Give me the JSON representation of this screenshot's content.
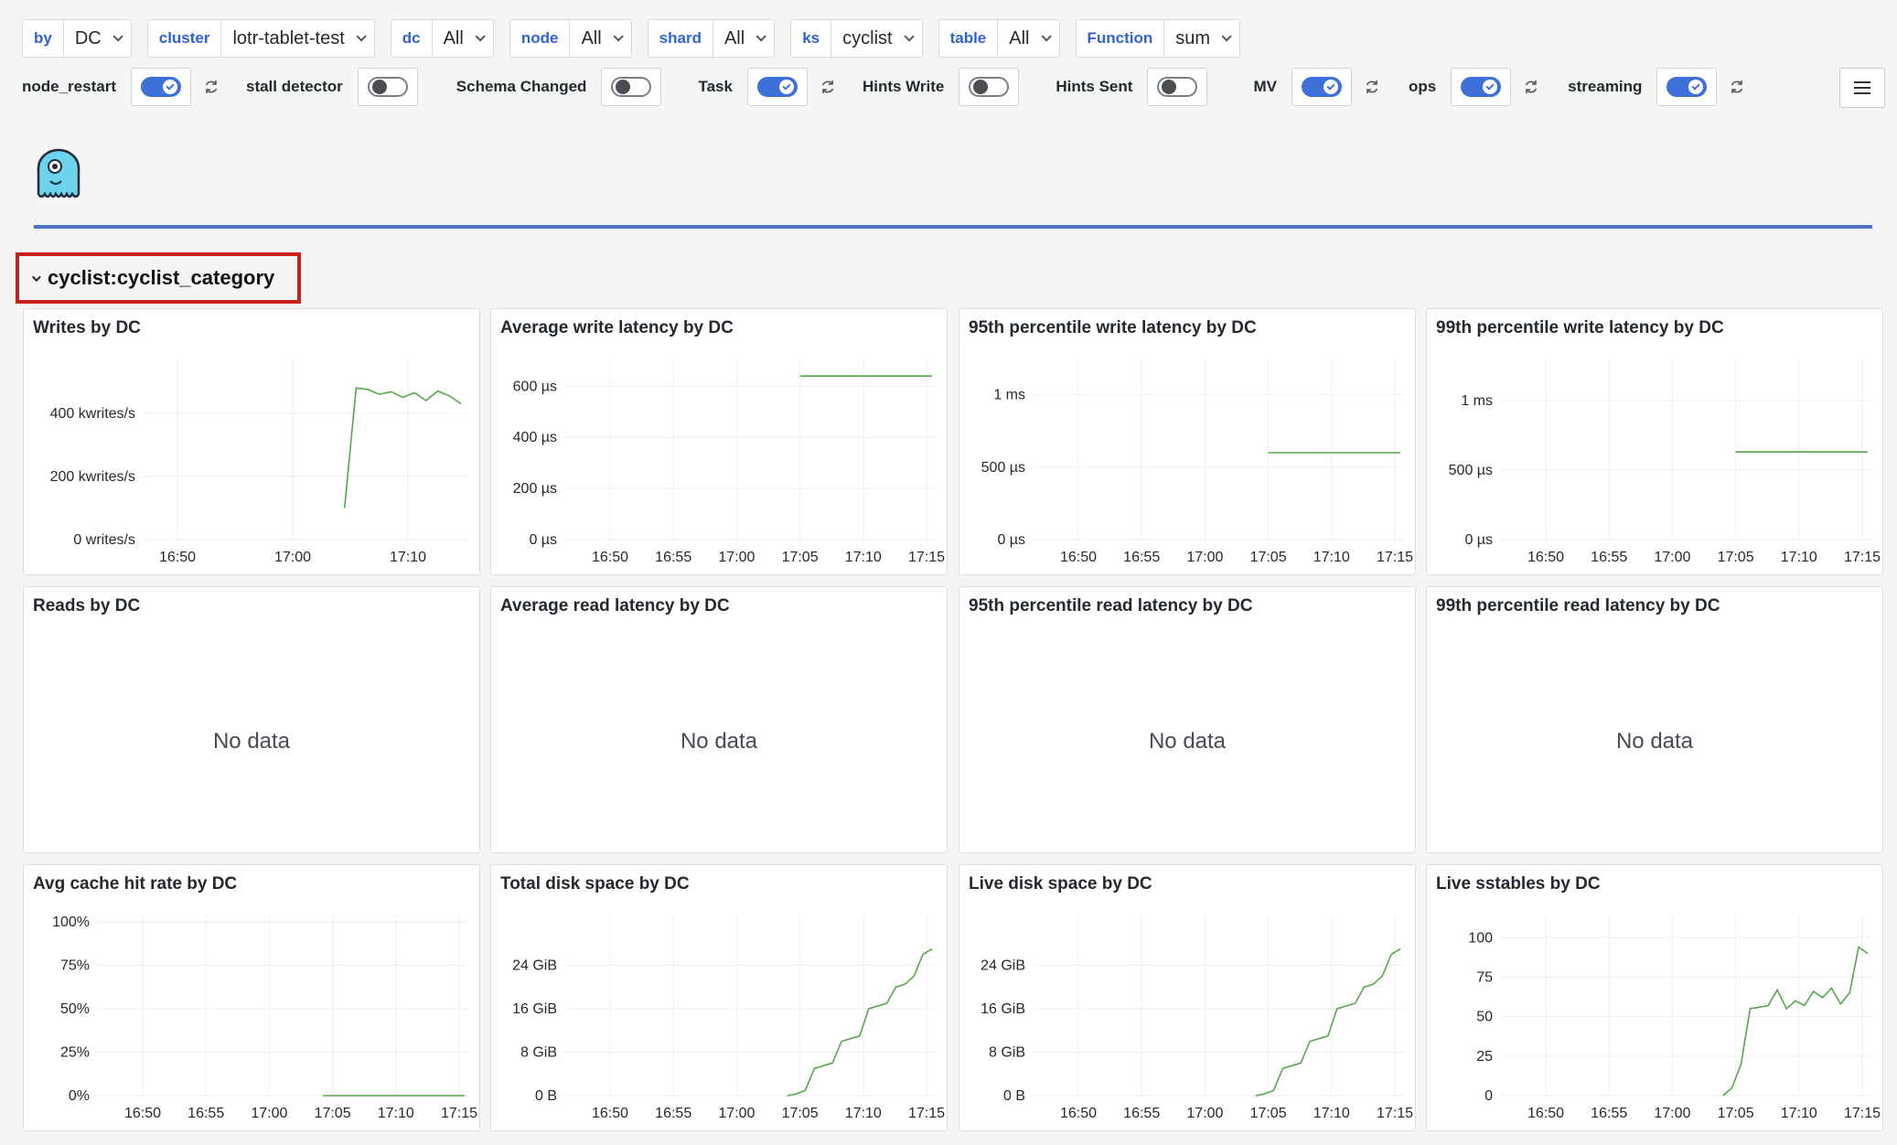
{
  "variables": [
    {
      "label": "by",
      "value": "DC"
    },
    {
      "label": "cluster",
      "value": "lotr-tablet-test"
    },
    {
      "label": "dc",
      "value": "All"
    },
    {
      "label": "node",
      "value": "All"
    },
    {
      "label": "shard",
      "value": "All"
    },
    {
      "label": "ks",
      "value": "cyclist"
    },
    {
      "label": "table",
      "value": "All"
    },
    {
      "label": "Function",
      "value": "sum"
    }
  ],
  "annotations": [
    {
      "label": "node_restart",
      "on": true,
      "refresh": true
    },
    {
      "label": "stall detector",
      "on": false,
      "refresh": false
    },
    {
      "label": "Schema Changed",
      "on": false,
      "refresh": false
    },
    {
      "label": "Task",
      "on": true,
      "refresh": true
    },
    {
      "label": "Hints Write",
      "on": false,
      "refresh": false
    },
    {
      "label": "Hints Sent",
      "on": false,
      "refresh": false
    },
    {
      "label": "MV",
      "on": true,
      "refresh": true
    },
    {
      "label": "ops",
      "on": true,
      "refresh": true
    },
    {
      "label": "streaming",
      "on": true,
      "refresh": true
    }
  ],
  "row": {
    "title": "cyclist:cyclist_category"
  },
  "colors": {
    "series": "#56a64b",
    "accent": "#3062d6",
    "highlight": "#c8211c"
  },
  "no_data_text": "No data",
  "panels": [
    {
      "title": "Writes by DC"
    },
    {
      "title": "Average write latency by DC"
    },
    {
      "title": "95th percentile write latency by DC"
    },
    {
      "title": "99th percentile write latency by DC"
    },
    {
      "title": "Reads by DC"
    },
    {
      "title": "Average read latency by DC"
    },
    {
      "title": "95th percentile read latency by DC"
    },
    {
      "title": "99th percentile read latency by DC"
    },
    {
      "title": "Avg cache hit rate by DC"
    },
    {
      "title": "Total disk space by DC"
    },
    {
      "title": "Live disk space by DC"
    },
    {
      "title": "Live sstables by DC"
    }
  ],
  "chart_data": [
    {
      "type": "line",
      "title": "Writes by DC",
      "xticks": [
        "16:50",
        "17:00",
        "17:10"
      ],
      "yticks": [
        "0 writes/s",
        "200 kwrites/s",
        "400 kwrites/s"
      ],
      "ylim": [
        0,
        550
      ],
      "x": [
        17.05,
        17.06,
        17.08,
        17.1,
        17.12,
        17.14,
        17.16,
        17.18,
        17.2,
        17.22,
        17.24
      ],
      "values": [
        100,
        480,
        475,
        460,
        468,
        450,
        465,
        440,
        470,
        455,
        430
      ]
    },
    {
      "type": "line",
      "title": "Average write latency by DC",
      "xticks": [
        "16:50",
        "16:55",
        "17:00",
        "17:05",
        "17:10",
        "17:15"
      ],
      "yticks": [
        "0 µs",
        "200 µs",
        "400 µs",
        "600 µs"
      ],
      "ylim": [
        0,
        680
      ],
      "x_start": "17:05",
      "x_end": "17:15",
      "values": [
        640,
        640
      ]
    },
    {
      "type": "line",
      "title": "95th percentile write latency by DC",
      "xticks": [
        "16:50",
        "16:55",
        "17:00",
        "17:05",
        "17:10",
        "17:15"
      ],
      "yticks": [
        "0 µs",
        "500 µs",
        "1 ms"
      ],
      "ylim": [
        0,
        1200
      ],
      "x_start": "17:05",
      "x_end": "17:15",
      "values": [
        600,
        600
      ]
    },
    {
      "type": "line",
      "title": "99th percentile write latency by DC",
      "xticks": [
        "16:50",
        "16:55",
        "17:00",
        "17:05",
        "17:10",
        "17:15"
      ],
      "yticks": [
        "0 µs",
        "500 µs",
        "1 ms"
      ],
      "ylim": [
        0,
        1250
      ],
      "x_start": "17:05",
      "x_end": "17:15",
      "values": [
        630,
        630
      ]
    },
    {
      "type": "line",
      "title": "Avg cache hit rate by DC",
      "xticks": [
        "16:50",
        "16:55",
        "17:00",
        "17:05",
        "17:10",
        "17:15"
      ],
      "yticks": [
        "0%",
        "25%",
        "50%",
        "75%",
        "100%"
      ],
      "ylim": [
        0,
        100
      ],
      "x_start": "17:04",
      "x_end": "17:15",
      "values": [
        0,
        0
      ]
    },
    {
      "type": "line",
      "title": "Total disk space by DC",
      "xticks": [
        "16:50",
        "16:55",
        "17:00",
        "17:05",
        "17:10",
        "17:15"
      ],
      "yticks": [
        "0 B",
        "8 GiB",
        "16 GiB",
        "24 GiB"
      ],
      "ylim": [
        0,
        32
      ],
      "values": [
        0,
        0.3,
        1,
        5,
        5.5,
        6,
        10,
        10.5,
        11,
        16,
        16.5,
        17,
        20,
        20.5,
        22,
        26,
        27
      ]
    },
    {
      "type": "line",
      "title": "Live disk space by DC",
      "xticks": [
        "16:50",
        "16:55",
        "17:00",
        "17:05",
        "17:10",
        "17:15"
      ],
      "yticks": [
        "0 B",
        "8 GiB",
        "16 GiB",
        "24 GiB"
      ],
      "ylim": [
        0,
        32
      ],
      "values": [
        0,
        0.3,
        1,
        5,
        5.5,
        6,
        10,
        10.5,
        11,
        16,
        16.5,
        17,
        20,
        20.5,
        22,
        26,
        27
      ]
    },
    {
      "type": "line",
      "title": "Live sstables by DC",
      "xticks": [
        "16:50",
        "16:55",
        "17:00",
        "17:05",
        "17:10",
        "17:15"
      ],
      "yticks": [
        "0",
        "25",
        "50",
        "75",
        "100"
      ],
      "ylim": [
        0,
        110
      ],
      "values": [
        0,
        5,
        20,
        55,
        56,
        57,
        67,
        55,
        60,
        57,
        66,
        62,
        68,
        58,
        65,
        94,
        90
      ]
    }
  ]
}
